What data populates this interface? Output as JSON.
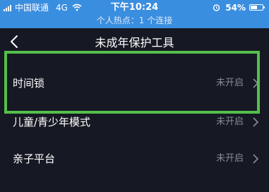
{
  "status_bar": {
    "carrier": "中国联通",
    "network": "4G",
    "time": "下午10:24",
    "battery_percent": "54%",
    "battery_level": 0.54,
    "hotspot_text": "个人热点：1 个连接",
    "background_color": "#3a8ee0"
  },
  "nav": {
    "title": "未成年保护工具",
    "back_icon": "chevron-left-icon"
  },
  "rows": [
    {
      "label": "时间锁",
      "status": "未开启"
    },
    {
      "label": "儿童/青少年模式",
      "status": "未开启"
    },
    {
      "label": "亲子平台",
      "status": "未开启"
    }
  ],
  "colors": {
    "background": "#161823",
    "status_text": "#8a8c94",
    "highlight": "#53c04a"
  }
}
